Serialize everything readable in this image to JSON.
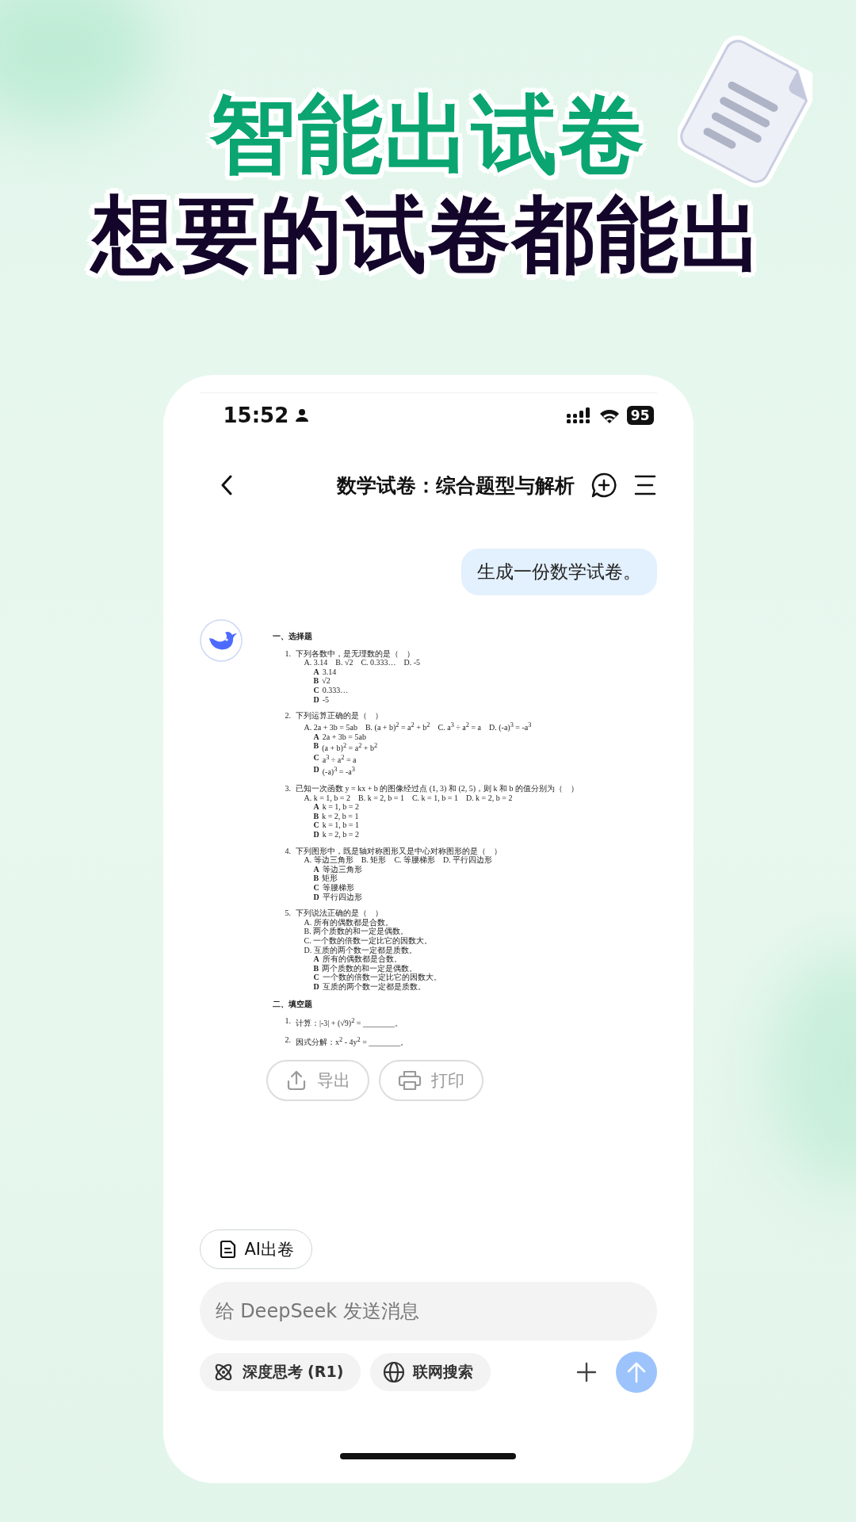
{
  "headline": {
    "title": "智能出试卷",
    "subtitle": "想要的试卷都能出"
  },
  "status_bar": {
    "time": "15:52",
    "battery": "95"
  },
  "nav": {
    "title": "数学试卷：综合题型与解析"
  },
  "messages": [
    {
      "kind": "user",
      "text": "生成一份数学试卷。"
    }
  ],
  "document": {
    "sections": [
      {
        "title": "一、选择题",
        "questions": [
          {
            "number": "1.",
            "stem": "下列各数中，是无理数的是（　）",
            "options": [
              "A. 3.14　B. √2　C. 0.333…　D. -5"
            ],
            "answers": [
              {
                "letter": "A",
                "text": "3.14"
              },
              {
                "letter": "B",
                "text": "√2"
              },
              {
                "letter": "C",
                "text": "0.333…"
              },
              {
                "letter": "D",
                "text": "-5"
              }
            ]
          },
          {
            "number": "2.",
            "stem": "下列运算正确的是（　）",
            "options": [
              "A. 2a + 3b = 5ab　B. (a + b)$^{2}$ = a$^{2}$ + b$^{2}$　C. a$^{3}$ ÷ a$^{2}$ = a　D. (-a)$^{3}$ = -a$^{3}$"
            ],
            "answers": [
              {
                "letter": "A",
                "text": "2a + 3b = 5ab"
              },
              {
                "letter": "B",
                "text": "(a + b)$^{2}$ = a$^{2}$ + b$^{2}$"
              },
              {
                "letter": "C",
                "text": "a$^{3}$ ÷ a$^{2}$ = a"
              },
              {
                "letter": "D",
                "text": "(-a)$^{3}$ = -a$^{3}$"
              }
            ]
          },
          {
            "number": "3.",
            "stem": "已知一次函数 y = kx + b 的图像经过点 (1, 3) 和 (2, 5)，则 k 和 b 的值分别为（　）",
            "options": [
              "A. k = 1, b = 2　B. k = 2, b = 1　C. k = 1, b = 1　D. k = 2, b = 2"
            ],
            "answers": [
              {
                "letter": "A",
                "text": "k = 1, b = 2"
              },
              {
                "letter": "B",
                "text": "k = 2, b = 1"
              },
              {
                "letter": "C",
                "text": "k = 1, b = 1"
              },
              {
                "letter": "D",
                "text": "k = 2, b = 2"
              }
            ]
          },
          {
            "number": "4.",
            "stem": "下列图形中，既是轴对称图形又是中心对称图形的是（　）",
            "options": [
              "A. 等边三角形　B. 矩形　C. 等腰梯形　D. 平行四边形"
            ],
            "answers": [
              {
                "letter": "A",
                "text": "等边三角形"
              },
              {
                "letter": "B",
                "text": "矩形"
              },
              {
                "letter": "C",
                "text": "等腰梯形"
              },
              {
                "letter": "D",
                "text": "平行四边形"
              }
            ]
          },
          {
            "number": "5.",
            "stem": "下列说法正确的是（　）",
            "options": [
              "A. 所有的偶数都是合数。",
              "B. 两个质数的和一定是偶数。",
              "C. 一个数的倍数一定比它的因数大。",
              "D. 互质的两个数一定都是质数。"
            ],
            "answers": [
              {
                "letter": "A",
                "text": "所有的偶数都是合数。"
              },
              {
                "letter": "B",
                "text": "两个质数的和一定是偶数。"
              },
              {
                "letter": "C",
                "text": "一个数的倍数一定比它的因数大。"
              },
              {
                "letter": "D",
                "text": "互质的两个数一定都是质数。"
              }
            ]
          }
        ]
      },
      {
        "title": "二、填空题",
        "questions": [
          {
            "number": "1.",
            "stem": "计算：|-3| + (√9)$^{2}$ = ________。"
          },
          {
            "number": "2.",
            "stem": "因式分解：x$^{2}$ - 4y$^{2}$ = ________。"
          }
        ]
      }
    ]
  },
  "actions": [
    {
      "kind": "export",
      "label": "导出"
    },
    {
      "kind": "print",
      "label": "打印"
    }
  ],
  "tool_chip": {
    "label": "AI出卷"
  },
  "composer": {
    "placeholder": "给 DeepSeek 发送消息"
  },
  "options": [
    {
      "kind": "think",
      "label": "深度思考 (R1)",
      "selected": false
    },
    {
      "kind": "search",
      "label": "联网搜索",
      "selected": false
    }
  ],
  "send": {
    "disabled": true
  }
}
